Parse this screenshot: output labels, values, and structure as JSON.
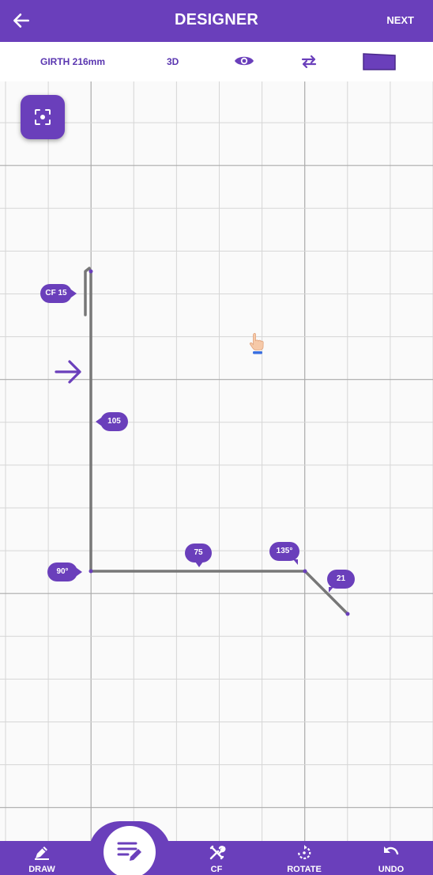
{
  "header": {
    "title": "DESIGNER",
    "next_label": "NEXT",
    "back_icon": "arrow-left-icon"
  },
  "toolbar": {
    "girth_label": "GIRTH 216mm",
    "view3d_label": "3D",
    "eye_icon": "eye-icon",
    "swap_icon": "swap-arrows-icon",
    "shape_icon": "trapezoid-shape-icon"
  },
  "drawing": {
    "crushfold_label": "CF 15",
    "segment_vertical_length": "105",
    "segment_horizontal_length": "75",
    "segment_diagonal_length": "21",
    "angle_bottom_left": "90°",
    "angle_bottom_right": "135°"
  },
  "bottom_nav": {
    "draw_label": "DRAW",
    "cf_label": "CF",
    "rotate_label": "ROTATE",
    "undo_label": "UNDO",
    "fab_icon": "edit-list-icon"
  },
  "colors": {
    "accent": "#6a3fbb",
    "line": "#777777",
    "grid_minor": "#d6d6d6",
    "grid_major": "#aaaaaa"
  }
}
